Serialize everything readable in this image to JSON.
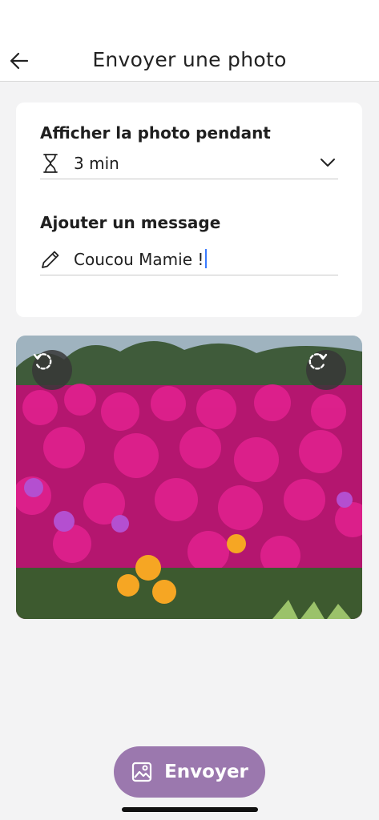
{
  "header": {
    "title": "Envoyer une photo",
    "back_icon": "arrow-left-icon"
  },
  "form": {
    "duration": {
      "label": "Afficher la photo pendant",
      "value": "3 min",
      "icon": "hourglass-icon",
      "dropdown_icon": "chevron-down-icon"
    },
    "message": {
      "label": "Ajouter un message",
      "value": "Coucou Mamie !",
      "icon": "pencil-icon"
    }
  },
  "photo": {
    "rotate_left_icon": "rotate-left-icon",
    "rotate_right_icon": "rotate-right-icon"
  },
  "send_button": {
    "label": "Envoyer",
    "icon": "image-icon",
    "color": "#9b78ae"
  }
}
